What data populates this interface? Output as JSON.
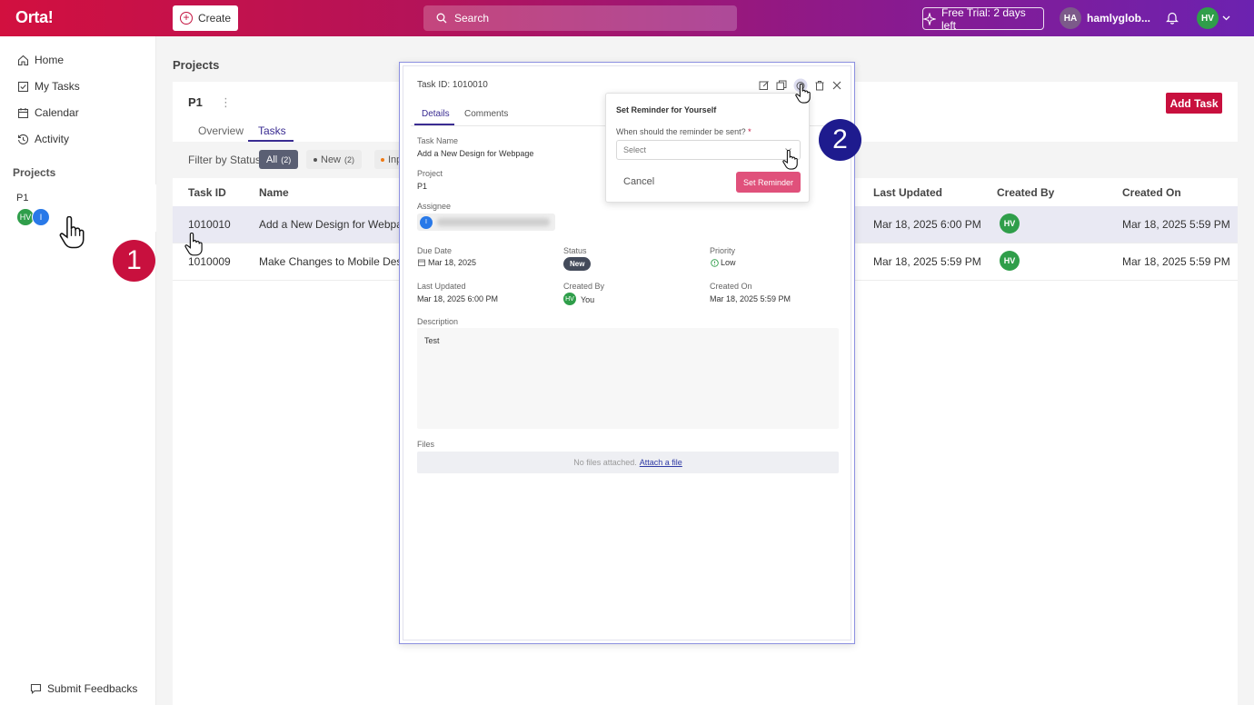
{
  "header": {
    "logo": "Orta!",
    "create_label": "Create",
    "search_placeholder": "Search",
    "trial_label": "Free Trial: 2 days left",
    "user_initials": "HA",
    "user_name": "hamlyglob...",
    "avatar_initials": "HV"
  },
  "sidebar": {
    "items": [
      {
        "label": "Home",
        "icon": "home-icon"
      },
      {
        "label": "My Tasks",
        "icon": "checkbox-icon"
      },
      {
        "label": "Calendar",
        "icon": "calendar-icon"
      },
      {
        "label": "Activity",
        "icon": "history-icon"
      }
    ],
    "projects_title": "Projects",
    "project": {
      "name": "P1",
      "members": [
        "HV",
        "I"
      ]
    },
    "feedback_label": "Submit Feedbacks"
  },
  "main": {
    "page_title": "Projects",
    "project_name": "P1",
    "more": "⋮",
    "tabs": [
      "Overview",
      "Tasks"
    ],
    "add_task_label": "Add Task",
    "filter_label": "Filter by Status:",
    "filters": [
      {
        "label": "All",
        "count": "(2)"
      },
      {
        "label": "New",
        "count": "(2)"
      },
      {
        "label": "Inp"
      }
    ],
    "columns": [
      "Task ID",
      "Name",
      "Last Updated",
      "Created By",
      "Created On"
    ],
    "rows": [
      {
        "id": "1010010",
        "name": "Add a New Design for Webpage",
        "updated": "Mar 18, 2025 6:00 PM",
        "by": "HV",
        "created": "Mar 18, 2025 5:59 PM"
      },
      {
        "id": "1010009",
        "name": "Make Changes to Mobile Design",
        "updated": "Mar 18, 2025 5:59 PM",
        "by": "HV",
        "created": "Mar 18, 2025 5:59 PM"
      }
    ]
  },
  "modal": {
    "task_id_label": "Task ID:",
    "task_id": "1010010",
    "tabs": [
      "Details",
      "Comments"
    ],
    "task_name_label": "Task Name",
    "task_name": "Add a New Design for Webpage",
    "project_label": "Project",
    "project": "P1",
    "assignee_label": "Assignee",
    "assignee_initial": "I",
    "due_label": "Due Date",
    "due": "Mar 18, 2025",
    "status_label": "Status",
    "status": "New",
    "priority_label": "Priority",
    "priority": "Low",
    "updated_label": "Last Updated",
    "updated": "Mar 18, 2025 6:00 PM",
    "created_by_label": "Created By",
    "created_by_initials": "HV",
    "created_by": "You",
    "created_on_label": "Created On",
    "created_on": "Mar 18, 2025 5:59 PM",
    "description_label": "Description",
    "description": "Test",
    "files_label": "Files",
    "no_files": "No files attached.",
    "attach_link": "Attach a file"
  },
  "reminder": {
    "title": "Set Reminder for Yourself",
    "question": "When should the reminder be sent?",
    "required_mark": "*",
    "select_placeholder": "Select",
    "cancel_label": "Cancel",
    "set_label": "Set Reminder"
  },
  "steps": [
    "1",
    "2"
  ],
  "colors": {
    "brand": "#c8103e",
    "accent": "#3a2c92",
    "step_red": "#c8103e",
    "step_blue": "#1e1b8e"
  }
}
